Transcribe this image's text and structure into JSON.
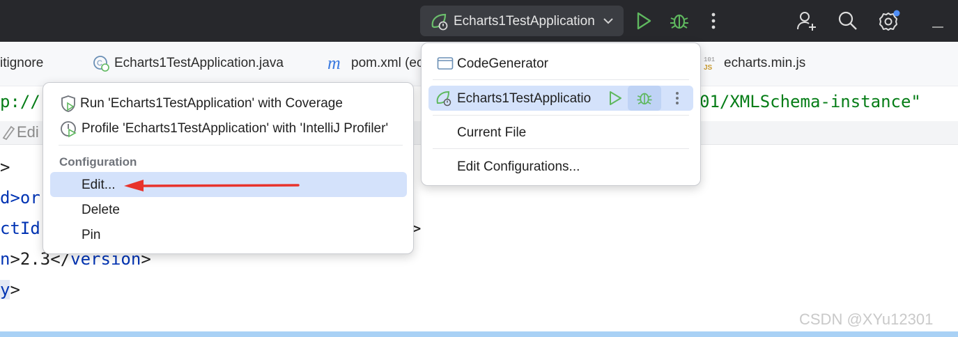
{
  "toolbar": {
    "run_config_label": "Echarts1TestApplication",
    "icons": [
      "run-config-icon",
      "chevron-down-icon",
      "run-icon",
      "debug-icon",
      "more-vertical-icon",
      "add-user-icon",
      "search-icon",
      "settings-icon",
      "minimize-icon"
    ]
  },
  "tabs": [
    {
      "label": "itignore",
      "icon": "gitignore-icon"
    },
    {
      "label": "Echarts1TestApplication.java",
      "icon": "spring-class-icon"
    },
    {
      "label": "pom.xml (ec",
      "icon": "maven-icon",
      "icon_text": "m"
    },
    {
      "label": "echarts.min.js",
      "icon": "js-file-icon",
      "icon_text": "101\nJS"
    }
  ],
  "code": {
    "line1_left": "p://",
    "line1_right": "01/XMLSchema-instance\"",
    "hint_label": "Edi",
    "line2": ">",
    "line3": "d>or",
    "line4": "ctId",
    "line4_tail": ">",
    "line5_a": "n",
    "line5_b": ">2.3</",
    "line5_c": "version",
    "line5_d": ">",
    "line6_a": "y",
    "line6_b": ">"
  },
  "context_menu": {
    "items": [
      {
        "label": "Run 'Echarts1TestApplication' with Coverage",
        "icon": "coverage-icon"
      },
      {
        "label": "Profile 'Echarts1TestApplication' with 'IntelliJ Profiler'",
        "icon": "profiler-icon"
      }
    ],
    "section_title": "Configuration",
    "config_items": [
      "Edit...",
      "Delete",
      "Pin"
    ],
    "selected": "Edit..."
  },
  "run_menu": {
    "items": [
      "CodeGenerator",
      "Echarts1TestApplicatio",
      "Current File",
      "Edit Configurations..."
    ],
    "selected": "Echarts1TestApplicatio"
  },
  "watermark": "CSDN @XYu12301",
  "colors": {
    "toolbar_bg": "#27282c",
    "run_green": "#5fb85f",
    "selection": "#d4e2fb",
    "arrow_red": "#e8332c",
    "code_green": "#067d17",
    "code_blue": "#0033b3"
  }
}
